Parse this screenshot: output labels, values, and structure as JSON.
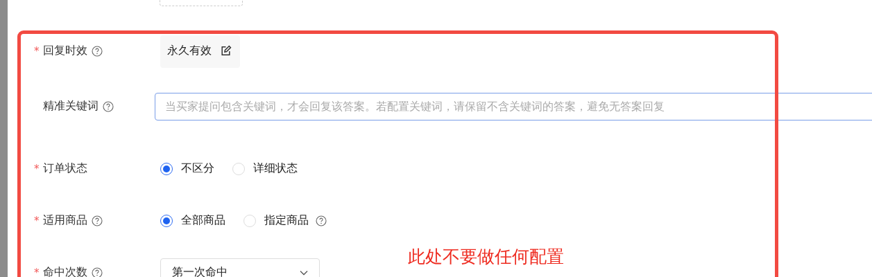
{
  "fields": [
    {
      "kind": "value_edit",
      "label": "回复时效",
      "required_mark": "*",
      "help": true,
      "value": "永久有效"
    },
    {
      "kind": "input",
      "label": "精准关键词",
      "help": true,
      "placeholder": "当买家提问包含关键词，才会回复该答案。若配置关键词，请保留不含关键词的答案，避免无答案回复"
    },
    {
      "kind": "radio",
      "label": "订单状态",
      "required_mark": "*",
      "options": [
        {
          "label": "不区分",
          "selected": true
        },
        {
          "label": "详细状态",
          "selected": false
        }
      ]
    },
    {
      "kind": "radio",
      "label": "适用商品",
      "required_mark": "*",
      "help": true,
      "options": [
        {
          "label": "全部商品",
          "selected": true
        },
        {
          "label": "指定商品",
          "selected": false,
          "help": true
        }
      ]
    },
    {
      "kind": "select",
      "label": "命中次数",
      "required_mark": "*",
      "help": true,
      "value": "第一次命中"
    }
  ],
  "annotation": {
    "text": "此处不要做任何配置"
  }
}
